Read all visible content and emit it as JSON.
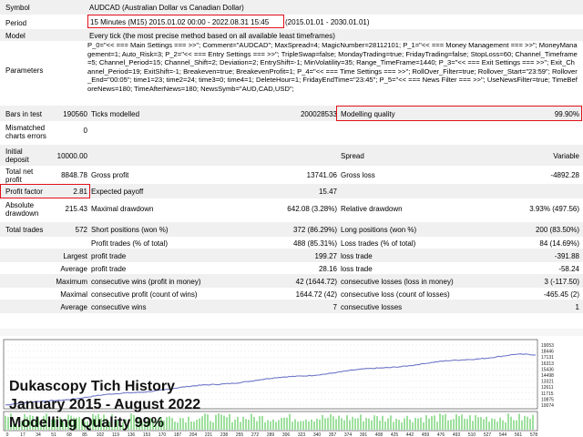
{
  "header": {
    "symbol_label": "Symbol",
    "symbol_value": "AUDCAD (Australian Dollar vs Canadian Dollar)",
    "period_label": "Period",
    "period_value_highlight": "15 Minutes (M15) 2015.01.02 00:00 - 2022.08.31 15:45",
    "period_value_rest": "(2015.01.01 - 2030.01.01)",
    "model_label": "Model",
    "model_value": "Every tick (the most precise method based on all available least timeframes)",
    "parameters_label": "Parameters",
    "parameters_value": "P_0=\"<< === Main Settings === >>\"; Comment=\"AUDCAD\"; MaxSpread=4; MagicNumber=28112101; P_1=\"<< === Money Management === >>\"; MoneyManagement=1; Auto_Risk=3; P_2=\"<< === Entry Settings === >>\"; TripleSwap=false; MondayTrading=true; FridayTrading=false; StopLoss=60; Channel_Timeframe=5; Channel_Period=15; Channel_Shift=2; Deviation=2; EntryShift=-1; MinVolatility=35; Range_TimeFrame=1440; P_3=\"<< === Exit Settings === >>\"; Exit_Channel_Period=19; ExitShift=-1; Breakeven=true; BreakevenProfit=1; P_4=\"<< === Time Settings === >>\"; RollOver_Filter=true; Rollover_Start=\"23:59\"; Rollover_End=\"00:05\"; time1=23; time2=24; time3=0; time4=1; DeleteHour=1; FridayEndTime=\"23:45\"; P_5=\"<< === News Filter === >>\"; UseNewsFilter=true; TimeBeforeNews=180; TimeAfterNews=180; NewsSymb=\"AUD,CAD,USD\";"
  },
  "stats": {
    "bars_label": "Bars in test",
    "bars_value": "190560",
    "ticks_label": "Ticks modelled",
    "ticks_value": "200028533",
    "quality_label": "Modelling quality",
    "quality_value": "99.90%",
    "mismatch_label": "Mismatched charts errors",
    "mismatch_value": "0",
    "deposit_label": "Initial deposit",
    "deposit_value": "10000.00",
    "spread_label": "Spread",
    "spread_value": "Variable",
    "netprofit_label": "Total net profit",
    "netprofit_value": "8848.78",
    "grossprofit_label": "Gross profit",
    "grossprofit_value": "13741.06",
    "grossloss_label": "Gross loss",
    "grossloss_value": "-4892.28",
    "pf_label": "Profit factor",
    "pf_value": "2.81",
    "payoff_label": "Expected payoff",
    "payoff_value": "15.47",
    "absdd_label": "Absolute drawdown",
    "absdd_value": "215.43",
    "maxdd_label": "Maximal drawdown",
    "maxdd_value": "642.08 (3.28%)",
    "reldd_label": "Relative drawdown",
    "reldd_value": "3.93% (497.56)",
    "trades_label": "Total trades",
    "trades_value": "572",
    "short_label": "Short positions (won %)",
    "short_value": "372 (86.29%)",
    "long_label": "Long positions (won %)",
    "long_value": "200 (83.50%)",
    "ptrades_label": "Profit trades (% of total)",
    "ptrades_value": "488 (85.31%)",
    "ltrades_label": "Loss trades (% of total)",
    "ltrades_value": "84 (14.69%)",
    "largest_label": "Largest",
    "largest_profit_label": "profit trade",
    "largest_profit_value": "199.27",
    "largest_loss_label": "loss trade",
    "largest_loss_value": "-391.88",
    "average_label": "Average",
    "average_profit_label": "profit trade",
    "average_profit_value": "28.16",
    "average_loss_label": "loss trade",
    "average_loss_value": "-58.24",
    "maximum_label": "Maximum",
    "max_cw_label": "consecutive wins (profit in money)",
    "max_cw_value": "42 (1644.72)",
    "max_cl_label": "consecutive losses (loss in money)",
    "max_cl_value": "3 (-117.50)",
    "maximal_label": "Maximal",
    "mxl_cp_label": "consecutive profit (count of wins)",
    "mxl_cp_value": "1644.72 (42)",
    "mxl_cl_label": "consecutive loss (count of losses)",
    "mxl_cl_value": "-465.45 (2)",
    "avg2_label": "Average",
    "avg_cw_label": "consecutive wins",
    "avg_cw_value": "7",
    "avg_cl_label": "consecutive losses",
    "avg_cl_value": "1"
  },
  "chart": {
    "overlay_line1": "Dukascopy Tich History",
    "overlay_line2": "January 2015 - August 2022",
    "overlay_line3": "Modelling Quality 99%",
    "balance_color": "#6f78c8",
    "volume_color": "#3cc23c",
    "y_ticks": [
      "19053",
      "18446",
      "17131",
      "16313",
      "15436",
      "14498",
      "13321",
      "12611",
      "11715",
      "10875",
      "10074"
    ],
    "x_ticks": [
      "0",
      "17",
      "34",
      "51",
      "68",
      "85",
      "102",
      "119",
      "136",
      "153",
      "170",
      "187",
      "204",
      "221",
      "238",
      "255",
      "272",
      "289",
      "306",
      "323",
      "340",
      "357",
      "374",
      "391",
      "408",
      "425",
      "442",
      "459",
      "476",
      "493",
      "510",
      "527",
      "544",
      "561",
      "578"
    ]
  }
}
